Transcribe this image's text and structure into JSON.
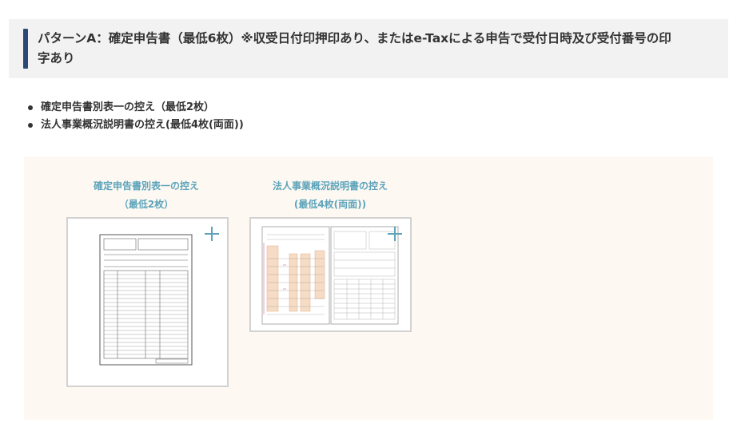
{
  "heading": {
    "line1": "パターンA：確定申告書（最低6枚）※収受日付印押印あり、またはe-Taxによる申告で受付日時及び受付番号の印",
    "line2": "字あり"
  },
  "bullets": [
    "確定申告書別表一の控え（最低2枚）",
    "法人事業概況説明書の控え(最低4枚(両面))"
  ],
  "thumbnails": [
    {
      "title": "確定申告書別表一の控え",
      "subtitle": "（最低2枚）",
      "expand_icon": "plus-icon"
    },
    {
      "title": "法人事業概況説明書の控え",
      "subtitle": "(最低4枚(両面))",
      "expand_icon": "plus-icon"
    }
  ],
  "colors": {
    "accent": "#5ea4bb",
    "heading_bar": "#2b4a73",
    "panel_bg": "#fdf9f2"
  }
}
